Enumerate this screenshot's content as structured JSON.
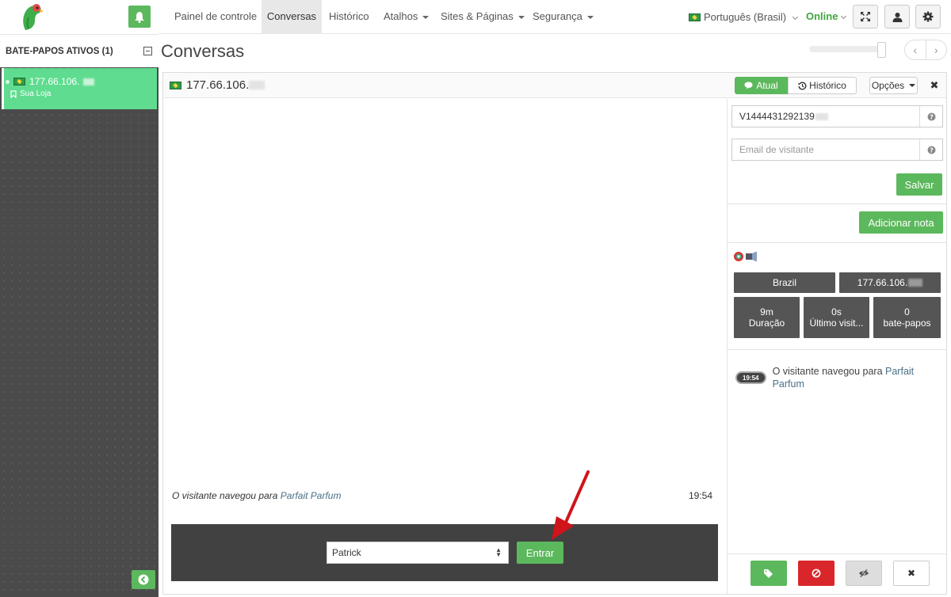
{
  "sidebar": {
    "active_chats_title": "BATE-PAPOS ATIVOS (1)",
    "chat_item": {
      "ip": "177.66.106.",
      "site": "Sua Loja"
    }
  },
  "topnav": {
    "items": [
      {
        "label": "Painel de controle"
      },
      {
        "label": "Conversas",
        "active": true
      },
      {
        "label": "Histórico"
      },
      {
        "label": "Atalhos"
      },
      {
        "label": "Sites & Páginas"
      },
      {
        "label": "Segurança"
      }
    ],
    "language": "Português (Brasil)",
    "status": "Online"
  },
  "page": {
    "title": "Conversas"
  },
  "chat": {
    "title_ip": "177.66.106.",
    "tab_current": "Atual",
    "tab_history": "Histórico",
    "options": "Opções",
    "messages": [
      {
        "text_prefix": "O visitante navegou para ",
        "link": "Parfait Parfum",
        "time": "19:54"
      }
    ],
    "operator": "Patrick",
    "join_label": "Entrar"
  },
  "info": {
    "visitor_id": "V1444431292139",
    "email_placeholder": "Email de visitante",
    "save_label": "Salvar",
    "add_note_label": "Adicionar nota",
    "country": "Brazil",
    "ip": "177.66.106.",
    "duration_value": "9m",
    "duration_label": "Duração",
    "last_visit_value": "0s",
    "last_visit_label": "Último visit...",
    "chats_value": "0",
    "chats_label": "bate-papos",
    "timeline": {
      "time": "19:54",
      "text_prefix": "O visitante navegou para ",
      "link": "Parfait Parfum"
    }
  },
  "colors": {
    "green": "#5cb85c",
    "sidebar": "#4a4a4a",
    "active_chat": "#5fdc8f",
    "danger": "#d9262b"
  }
}
